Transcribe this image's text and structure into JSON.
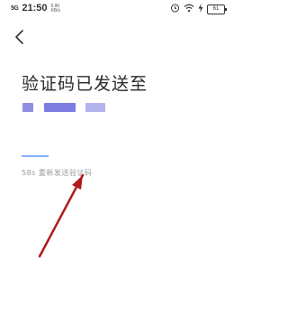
{
  "status_bar": {
    "signal": "5G",
    "time": "21:50",
    "net_speed_value": "5.90",
    "net_speed_unit": "KB/s",
    "battery": "61"
  },
  "page": {
    "title": "验证码已发送至",
    "resend_text": "58s 重新发送验证码"
  },
  "colors": {
    "masked_segment_1": "#8f8fe0",
    "masked_segment_2": "#7c7ce2",
    "masked_segment_3": "#b3b3ee",
    "annotation_arrow": "#b11a1a"
  }
}
